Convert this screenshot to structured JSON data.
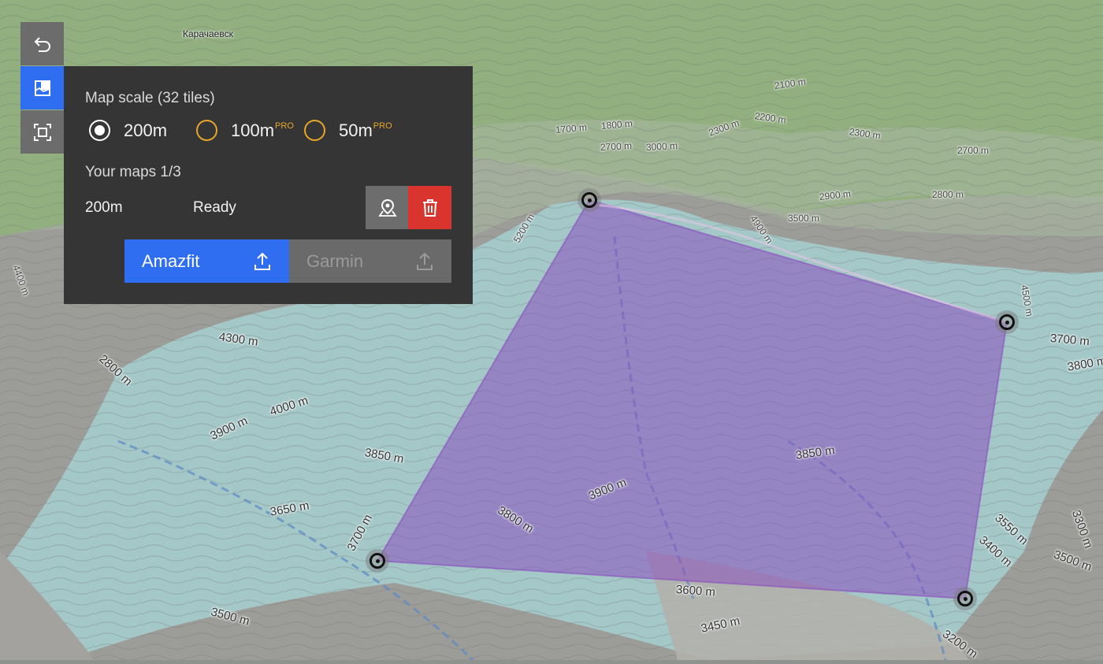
{
  "toolbar": {
    "items": [
      {
        "name": "back",
        "icon": "undo-arrow-icon",
        "active": false
      },
      {
        "name": "map-download",
        "icon": "map-download-icon",
        "active": true
      },
      {
        "name": "area-select",
        "icon": "frame-select-icon",
        "active": false
      }
    ]
  },
  "panel": {
    "scale_title": "Map scale (32 tiles)",
    "scale_options": [
      {
        "label": "200m",
        "pro": "",
        "selected": true
      },
      {
        "label": "100m",
        "pro": "PRO",
        "selected": false
      },
      {
        "label": "50m",
        "pro": "PRO",
        "selected": false
      }
    ],
    "maps_title": "Your maps 1/3",
    "map_item": {
      "scale": "200m",
      "status": "Ready"
    },
    "export": {
      "amazfit": {
        "label": "Amazfit",
        "icon": "upload-icon",
        "enabled": true
      },
      "garmin": {
        "label": "Garmin",
        "icon": "upload-icon",
        "enabled": false
      }
    }
  },
  "colors": {
    "accent": "#2f6ef0",
    "danger": "#d9352e",
    "pro": "#e9a62a",
    "panel_bg": "#353535",
    "selection_fill": "#8a4fc0"
  },
  "map": {
    "town": "Карачаевск",
    "labels": [
      "2100 m",
      "2200 m",
      "1700 m",
      "1800 m",
      "2300 m",
      "2300 m",
      "2700 m",
      "3000 m",
      "2700 m",
      "2900 m",
      "2800 m",
      "3500 m",
      "4900 m",
      "5200 m",
      "3700 m",
      "3800 m",
      "4300 m",
      "2800 m",
      "4000 m",
      "3900 m",
      "3850 m",
      "3650 m",
      "3700 m",
      "3800 m",
      "3900 m",
      "3850 m",
      "3600 m",
      "3550 m",
      "3400 m",
      "3500 m",
      "3450 m",
      "3500 m",
      "3200 m",
      "3300 m",
      "4400 m",
      "4500 m"
    ]
  }
}
